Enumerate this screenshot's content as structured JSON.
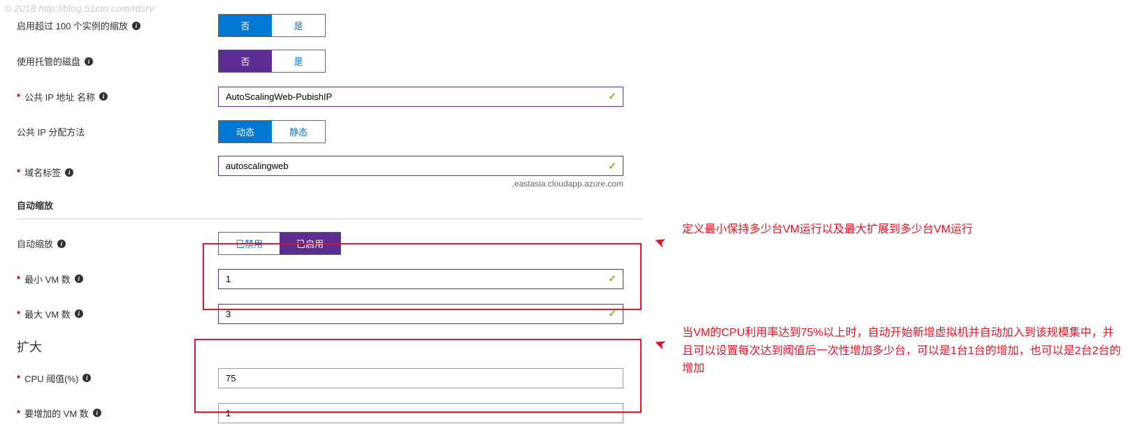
{
  "watermark": "© 2018 http://blog.51cto.com/rdsrv",
  "fields": {
    "overprovision": {
      "label": "启用超过 100 个实例的缩放",
      "option_no": "否",
      "option_yes": "是"
    },
    "managed_disk": {
      "label": "使用托管的磁盘",
      "option_no": "否",
      "option_yes": "是"
    },
    "public_ip_name": {
      "label": "公共 IP 地址 名称",
      "value": "AutoScalingWeb-PubishIP"
    },
    "ip_allocation": {
      "label": "公共 IP 分配方法",
      "option_dynamic": "动态",
      "option_static": "静态"
    },
    "domain_label": {
      "label": "域名标签",
      "value": "autoscalingweb",
      "suffix": ".eastasia.cloudapp.azure.com"
    },
    "autoscale_section": "自动缩放",
    "autoscale": {
      "label": "自动缩放",
      "option_disabled": "已禁用",
      "option_enabled": "已启用"
    },
    "min_vm": {
      "label": "最小 VM 数",
      "value": "1"
    },
    "max_vm": {
      "label": "最大 VM 数",
      "value": "3"
    },
    "scale_out_section": "扩大",
    "cpu_threshold": {
      "label": "CPU 阈值(%)",
      "value": "75"
    },
    "vm_to_add": {
      "label": "要增加的 VM 数",
      "value": "1"
    }
  },
  "annotations": {
    "ann1": "定义最小保持多少台VM运行以及最大扩展到多少台VM运行",
    "ann2": "当VM的CPU利用率达到75%以上时，自动开始新增虚拟机并自动加入到该规模集中，并且可以设置每次达到阈值后一次性增加多少台，可以是1台1台的增加，也可以是2台2台的增加"
  }
}
